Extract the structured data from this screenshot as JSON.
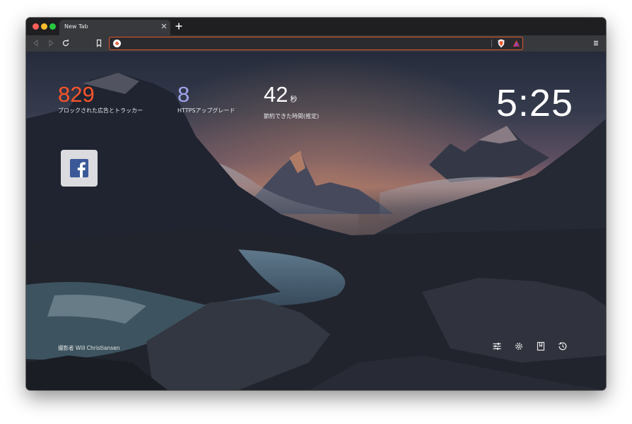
{
  "window": {
    "tab": {
      "title": "New Tab"
    }
  },
  "toolbar": {
    "url": {
      "value": "",
      "placeholder": ""
    }
  },
  "stats": [
    {
      "value": "829",
      "unit": "",
      "label": "ブロックされた広告とトラッカー",
      "color": "#fb542b"
    },
    {
      "value": "8",
      "unit": "",
      "label": "HTTPSアップグレード",
      "color": "#a0a5eb"
    },
    {
      "value": "42",
      "unit": "秒",
      "label": "節約できた時間(推定)",
      "color": "#ffffff"
    }
  ],
  "clock": "5:25",
  "top_sites": [
    {
      "name": "Facebook",
      "icon": "facebook-icon"
    }
  ],
  "photo_credit": "撮影者 Will Christiansen",
  "bottom_icons": [
    "customize-icon",
    "settings-icon",
    "bookmarks-icon",
    "history-icon"
  ],
  "colors": {
    "accent": "#fb542b",
    "url_border": "#e2562b"
  }
}
